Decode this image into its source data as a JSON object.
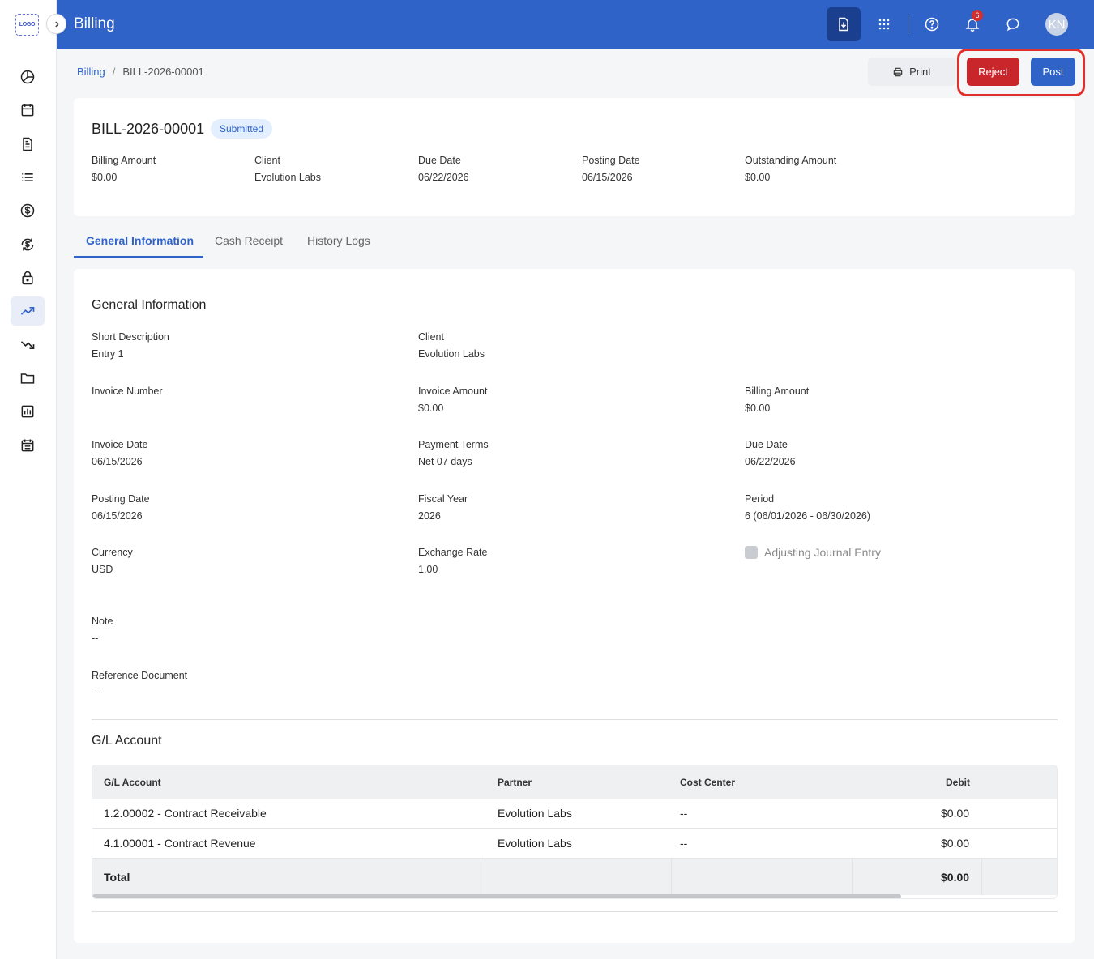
{
  "sidebar": {
    "logo_text": "LOGO",
    "items": [
      {
        "icon": "pie-chart-icon"
      },
      {
        "icon": "calendar-icon"
      },
      {
        "icon": "document-icon"
      },
      {
        "icon": "list-icon"
      },
      {
        "icon": "dollar-circle-icon"
      },
      {
        "icon": "dollar-refresh-icon"
      },
      {
        "icon": "lock-icon"
      },
      {
        "icon": "trending-up-icon",
        "active": true
      },
      {
        "icon": "trending-down-icon"
      },
      {
        "icon": "folder-icon"
      },
      {
        "icon": "bar-chart-icon"
      },
      {
        "icon": "calendar-list-icon"
      }
    ]
  },
  "header": {
    "title": "Billing",
    "notification_count": "6",
    "avatar_initials": "KN",
    "color": "#2f63c8"
  },
  "breadcrumb": {
    "root": "Billing",
    "separator": "/",
    "current": "BILL-2026-00001"
  },
  "actions": {
    "print": "Print",
    "reject": "Reject",
    "post": "Post"
  },
  "summary": {
    "bill_id": "BILL-2026-00001",
    "status": "Submitted",
    "fields": [
      {
        "label": "Billing Amount",
        "value": "$0.00"
      },
      {
        "label": "Client",
        "value": "Evolution Labs"
      },
      {
        "label": "Due Date",
        "value": "06/22/2026"
      },
      {
        "label": "Posting Date",
        "value": "06/15/2026"
      },
      {
        "label": "Outstanding Amount",
        "value": "$0.00"
      }
    ]
  },
  "tabs": [
    {
      "label": "General Information",
      "active": true
    },
    {
      "label": "Cash Receipt"
    },
    {
      "label": "History Logs"
    }
  ],
  "general": {
    "title": "General Information",
    "short_description": {
      "label": "Short Description",
      "value": "Entry 1"
    },
    "client": {
      "label": "Client",
      "value": "Evolution Labs"
    },
    "invoice_number": {
      "label": "Invoice Number",
      "value": ""
    },
    "invoice_amount": {
      "label": "Invoice Amount",
      "value": "$0.00"
    },
    "billing_amount": {
      "label": "Billing Amount",
      "value": "$0.00"
    },
    "invoice_date": {
      "label": "Invoice Date",
      "value": "06/15/2026"
    },
    "payment_terms": {
      "label": "Payment Terms",
      "value": "Net 07 days"
    },
    "due_date": {
      "label": "Due Date",
      "value": "06/22/2026"
    },
    "posting_date": {
      "label": "Posting Date",
      "value": "06/15/2026"
    },
    "fiscal_year": {
      "label": "Fiscal Year",
      "value": "2026"
    },
    "period": {
      "label": "Period",
      "value": "6 (06/01/2026 - 06/30/2026)"
    },
    "currency": {
      "label": "Currency",
      "value": "USD"
    },
    "exchange_rate": {
      "label": "Exchange Rate",
      "value": "1.00"
    },
    "adjusting_entry": {
      "label": "Adjusting Journal Entry",
      "checked": false
    },
    "note": {
      "label": "Note",
      "value": "--"
    },
    "reference_document": {
      "label": "Reference Document",
      "value": "--"
    }
  },
  "gl": {
    "title": "G/L Account",
    "columns": [
      "G/L Account",
      "Partner",
      "Cost Center",
      "Debit"
    ],
    "rows": [
      {
        "account": "1.2.00002 - Contract Receivable",
        "partner": "Evolution Labs",
        "cost_center": "--",
        "debit": "$0.00"
      },
      {
        "account": "4.1.00001 - Contract Revenue",
        "partner": "Evolution Labs",
        "cost_center": "--",
        "debit": "$0.00"
      }
    ],
    "total_label": "Total",
    "total_debit": "$0.00"
  }
}
